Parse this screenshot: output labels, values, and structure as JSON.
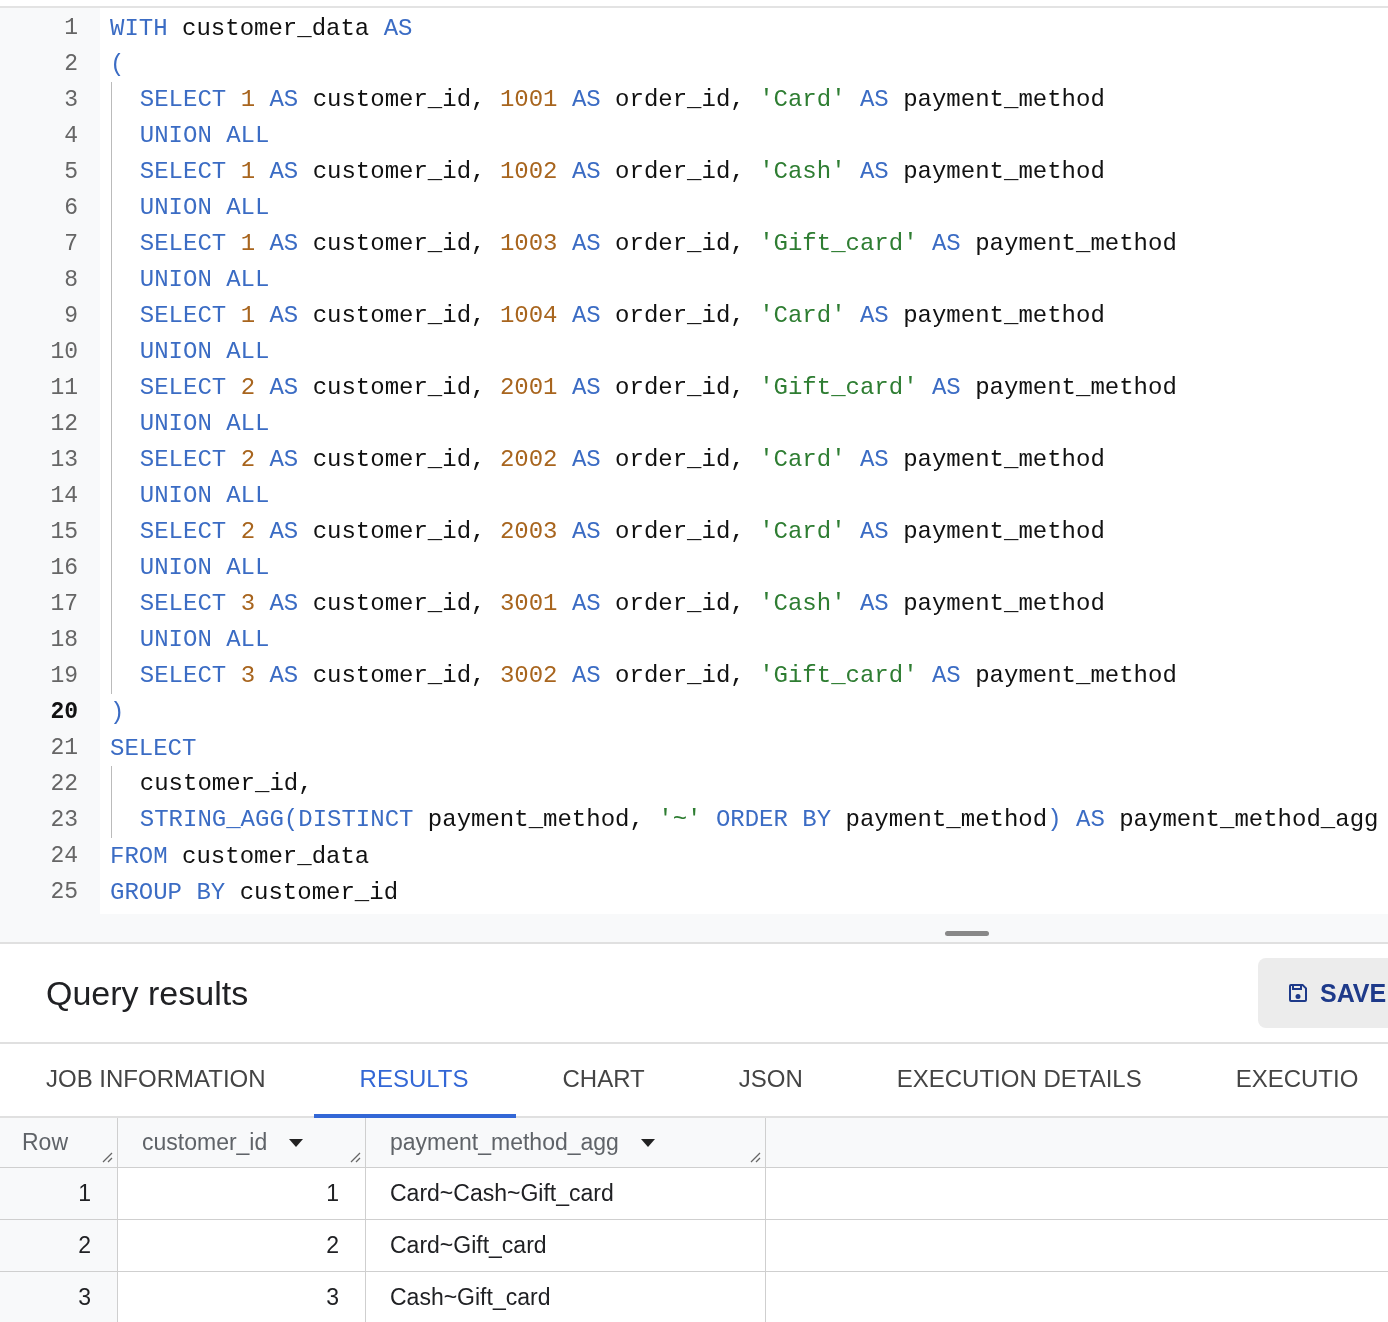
{
  "editor": {
    "lines": [
      {
        "number": "1",
        "selected": false,
        "indented": false,
        "tokens": [
          {
            "kind": "keyword",
            "text": "WITH "
          },
          {
            "kind": "ident",
            "text": "customer_data "
          },
          {
            "kind": "keyword",
            "text": "AS"
          }
        ]
      },
      {
        "number": "2",
        "selected": false,
        "indented": false,
        "tokens": [
          {
            "kind": "keyword",
            "text": "("
          }
        ]
      },
      {
        "number": "3",
        "selected": false,
        "indented": true,
        "tokens": [
          {
            "kind": "keyword",
            "text": "SELECT "
          },
          {
            "kind": "number",
            "text": "1"
          },
          {
            "kind": "keyword",
            "text": " AS "
          },
          {
            "kind": "ident",
            "text": "customer_id, "
          },
          {
            "kind": "number",
            "text": "1001"
          },
          {
            "kind": "keyword",
            "text": " AS "
          },
          {
            "kind": "ident",
            "text": "order_id, "
          },
          {
            "kind": "string",
            "text": "'Card'"
          },
          {
            "kind": "keyword",
            "text": " AS "
          },
          {
            "kind": "ident",
            "text": "payment_method"
          }
        ]
      },
      {
        "number": "4",
        "selected": false,
        "indented": true,
        "tokens": [
          {
            "kind": "keyword",
            "text": "UNION ALL"
          }
        ]
      },
      {
        "number": "5",
        "selected": false,
        "indented": true,
        "tokens": [
          {
            "kind": "keyword",
            "text": "SELECT "
          },
          {
            "kind": "number",
            "text": "1"
          },
          {
            "kind": "keyword",
            "text": " AS "
          },
          {
            "kind": "ident",
            "text": "customer_id, "
          },
          {
            "kind": "number",
            "text": "1002"
          },
          {
            "kind": "keyword",
            "text": " AS "
          },
          {
            "kind": "ident",
            "text": "order_id, "
          },
          {
            "kind": "string",
            "text": "'Cash'"
          },
          {
            "kind": "keyword",
            "text": " AS "
          },
          {
            "kind": "ident",
            "text": "payment_method"
          }
        ]
      },
      {
        "number": "6",
        "selected": false,
        "indented": true,
        "tokens": [
          {
            "kind": "keyword",
            "text": "UNION ALL"
          }
        ]
      },
      {
        "number": "7",
        "selected": false,
        "indented": true,
        "tokens": [
          {
            "kind": "keyword",
            "text": "SELECT "
          },
          {
            "kind": "number",
            "text": "1"
          },
          {
            "kind": "keyword",
            "text": " AS "
          },
          {
            "kind": "ident",
            "text": "customer_id, "
          },
          {
            "kind": "number",
            "text": "1003"
          },
          {
            "kind": "keyword",
            "text": " AS "
          },
          {
            "kind": "ident",
            "text": "order_id, "
          },
          {
            "kind": "string",
            "text": "'Gift_card'"
          },
          {
            "kind": "keyword",
            "text": " AS "
          },
          {
            "kind": "ident",
            "text": "payment_method"
          }
        ]
      },
      {
        "number": "8",
        "selected": false,
        "indented": true,
        "tokens": [
          {
            "kind": "keyword",
            "text": "UNION ALL"
          }
        ]
      },
      {
        "number": "9",
        "selected": false,
        "indented": true,
        "tokens": [
          {
            "kind": "keyword",
            "text": "SELECT "
          },
          {
            "kind": "number",
            "text": "1"
          },
          {
            "kind": "keyword",
            "text": " AS "
          },
          {
            "kind": "ident",
            "text": "customer_id, "
          },
          {
            "kind": "number",
            "text": "1004"
          },
          {
            "kind": "keyword",
            "text": " AS "
          },
          {
            "kind": "ident",
            "text": "order_id, "
          },
          {
            "kind": "string",
            "text": "'Card'"
          },
          {
            "kind": "keyword",
            "text": " AS "
          },
          {
            "kind": "ident",
            "text": "payment_method"
          }
        ]
      },
      {
        "number": "10",
        "selected": false,
        "indented": true,
        "tokens": [
          {
            "kind": "keyword",
            "text": "UNION ALL"
          }
        ]
      },
      {
        "number": "11",
        "selected": false,
        "indented": true,
        "tokens": [
          {
            "kind": "keyword",
            "text": "SELECT "
          },
          {
            "kind": "number",
            "text": "2"
          },
          {
            "kind": "keyword",
            "text": " AS "
          },
          {
            "kind": "ident",
            "text": "customer_id, "
          },
          {
            "kind": "number",
            "text": "2001"
          },
          {
            "kind": "keyword",
            "text": " AS "
          },
          {
            "kind": "ident",
            "text": "order_id, "
          },
          {
            "kind": "string",
            "text": "'Gift_card'"
          },
          {
            "kind": "keyword",
            "text": " AS "
          },
          {
            "kind": "ident",
            "text": "payment_method"
          }
        ]
      },
      {
        "number": "12",
        "selected": false,
        "indented": true,
        "tokens": [
          {
            "kind": "keyword",
            "text": "UNION ALL"
          }
        ]
      },
      {
        "number": "13",
        "selected": false,
        "indented": true,
        "tokens": [
          {
            "kind": "keyword",
            "text": "SELECT "
          },
          {
            "kind": "number",
            "text": "2"
          },
          {
            "kind": "keyword",
            "text": " AS "
          },
          {
            "kind": "ident",
            "text": "customer_id, "
          },
          {
            "kind": "number",
            "text": "2002"
          },
          {
            "kind": "keyword",
            "text": " AS "
          },
          {
            "kind": "ident",
            "text": "order_id, "
          },
          {
            "kind": "string",
            "text": "'Card'"
          },
          {
            "kind": "keyword",
            "text": " AS "
          },
          {
            "kind": "ident",
            "text": "payment_method"
          }
        ]
      },
      {
        "number": "14",
        "selected": false,
        "indented": true,
        "tokens": [
          {
            "kind": "keyword",
            "text": "UNION ALL"
          }
        ]
      },
      {
        "number": "15",
        "selected": false,
        "indented": true,
        "tokens": [
          {
            "kind": "keyword",
            "text": "SELECT "
          },
          {
            "kind": "number",
            "text": "2"
          },
          {
            "kind": "keyword",
            "text": " AS "
          },
          {
            "kind": "ident",
            "text": "customer_id, "
          },
          {
            "kind": "number",
            "text": "2003"
          },
          {
            "kind": "keyword",
            "text": " AS "
          },
          {
            "kind": "ident",
            "text": "order_id, "
          },
          {
            "kind": "string",
            "text": "'Card'"
          },
          {
            "kind": "keyword",
            "text": " AS "
          },
          {
            "kind": "ident",
            "text": "payment_method"
          }
        ]
      },
      {
        "number": "16",
        "selected": false,
        "indented": true,
        "tokens": [
          {
            "kind": "keyword",
            "text": "UNION ALL"
          }
        ]
      },
      {
        "number": "17",
        "selected": false,
        "indented": true,
        "tokens": [
          {
            "kind": "keyword",
            "text": "SELECT "
          },
          {
            "kind": "number",
            "text": "3"
          },
          {
            "kind": "keyword",
            "text": " AS "
          },
          {
            "kind": "ident",
            "text": "customer_id, "
          },
          {
            "kind": "number",
            "text": "3001"
          },
          {
            "kind": "keyword",
            "text": " AS "
          },
          {
            "kind": "ident",
            "text": "order_id, "
          },
          {
            "kind": "string",
            "text": "'Cash'"
          },
          {
            "kind": "keyword",
            "text": " AS "
          },
          {
            "kind": "ident",
            "text": "payment_method"
          }
        ]
      },
      {
        "number": "18",
        "selected": false,
        "indented": true,
        "tokens": [
          {
            "kind": "keyword",
            "text": "UNION ALL"
          }
        ]
      },
      {
        "number": "19",
        "selected": false,
        "indented": true,
        "tokens": [
          {
            "kind": "keyword",
            "text": "SELECT "
          },
          {
            "kind": "number",
            "text": "3"
          },
          {
            "kind": "keyword",
            "text": " AS "
          },
          {
            "kind": "ident",
            "text": "customer_id, "
          },
          {
            "kind": "number",
            "text": "3002"
          },
          {
            "kind": "keyword",
            "text": " AS "
          },
          {
            "kind": "ident",
            "text": "order_id, "
          },
          {
            "kind": "string",
            "text": "'Gift_card'"
          },
          {
            "kind": "keyword",
            "text": " AS "
          },
          {
            "kind": "ident",
            "text": "payment_method"
          }
        ]
      },
      {
        "number": "20",
        "selected": true,
        "indented": false,
        "tokens": [
          {
            "kind": "keyword",
            "text": ")"
          }
        ]
      },
      {
        "number": "21",
        "selected": false,
        "indented": false,
        "tokens": [
          {
            "kind": "keyword",
            "text": "SELECT"
          }
        ]
      },
      {
        "number": "22",
        "selected": false,
        "indented": true,
        "tokens": [
          {
            "kind": "ident",
            "text": "customer_id,"
          }
        ]
      },
      {
        "number": "23",
        "selected": false,
        "indented": true,
        "tokens": [
          {
            "kind": "keyword",
            "text": "STRING_AGG(DISTINCT "
          },
          {
            "kind": "ident",
            "text": "payment_method, "
          },
          {
            "kind": "string",
            "text": "'~'"
          },
          {
            "kind": "keyword",
            "text": " ORDER BY "
          },
          {
            "kind": "ident",
            "text": "payment_method"
          },
          {
            "kind": "keyword",
            "text": ")"
          },
          {
            "kind": "keyword",
            "text": " AS "
          },
          {
            "kind": "ident",
            "text": "payment_method_agg"
          }
        ]
      },
      {
        "number": "24",
        "selected": false,
        "indented": false,
        "tokens": [
          {
            "kind": "keyword",
            "text": "FROM "
          },
          {
            "kind": "ident",
            "text": "customer_data"
          }
        ]
      },
      {
        "number": "25",
        "selected": false,
        "indented": false,
        "tokens": [
          {
            "kind": "keyword",
            "text": "GROUP BY "
          },
          {
            "kind": "ident",
            "text": "customer_id"
          }
        ]
      }
    ]
  },
  "results": {
    "title": "Query results",
    "save_button": "SAVE",
    "tabs": [
      {
        "label": "JOB INFORMATION",
        "selected": false
      },
      {
        "label": "RESULTS",
        "selected": true
      },
      {
        "label": "CHART",
        "selected": false
      },
      {
        "label": "JSON",
        "selected": false
      },
      {
        "label": "EXECUTION DETAILS",
        "selected": false
      },
      {
        "label": "EXECUTIO",
        "selected": false
      }
    ],
    "table": {
      "columns": [
        {
          "label": "Row",
          "menu": false
        },
        {
          "label": "customer_id",
          "menu": true
        },
        {
          "label": "payment_method_agg",
          "menu": true
        }
      ],
      "rows": [
        [
          "1",
          "1",
          "Card~Cash~Gift_card"
        ],
        [
          "2",
          "2",
          "Card~Gift_card"
        ],
        [
          "3",
          "3",
          "Cash~Gift_card"
        ]
      ]
    }
  }
}
